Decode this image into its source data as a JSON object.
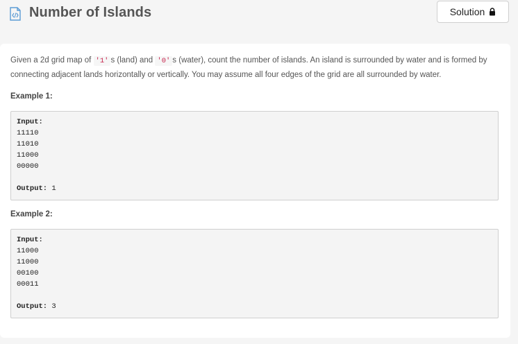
{
  "header": {
    "title": "Number of Islands",
    "solution_label": "Solution"
  },
  "description": {
    "part1": "Given a 2d grid map of ",
    "code1": "'1'",
    "part2": "s (land) and ",
    "code2": "'0'",
    "part3": "s (water), count the number of islands. An island is surrounded by water and is formed by connecting adjacent lands horizontally or vertically. You may assume all four edges of the grid are all surrounded by water."
  },
  "examples": [
    {
      "label": "Example 1:",
      "input_label": "Input:",
      "grid": [
        "11110",
        "11010",
        "11000",
        "00000"
      ],
      "output_label": "Output:",
      "output_value": "1"
    },
    {
      "label": "Example 2:",
      "input_label": "Input:",
      "grid": [
        "11000",
        "11000",
        "00100",
        "00011"
      ],
      "output_label": "Output:",
      "output_value": "3"
    }
  ],
  "icons": {
    "doc": "code-document-icon",
    "lock": "lock-icon"
  },
  "colors": {
    "inline_code": "#c7254e",
    "icon": "#5b9bd5"
  }
}
